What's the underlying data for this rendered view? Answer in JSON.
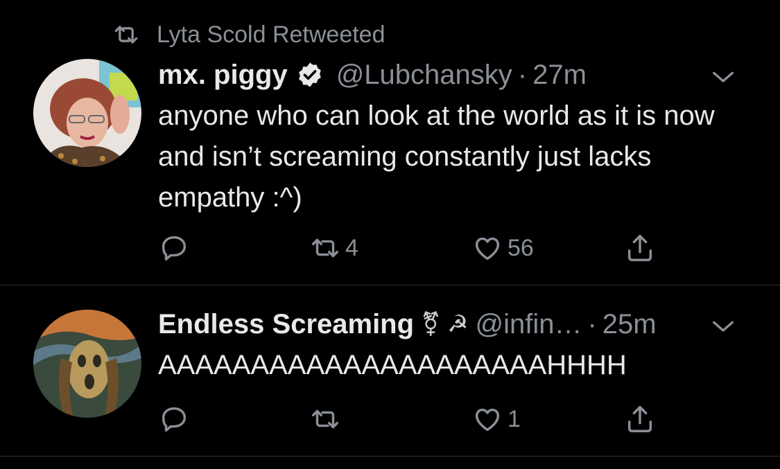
{
  "tweets": [
    {
      "retweeted_by": "Lyta Scold Retweeted",
      "display_name": "mx. piggy",
      "verified": true,
      "handle": "@Lubchansky",
      "separator": "·",
      "time": "27m",
      "text": "anyone who can look at the world as it is now and isn’t screaming constantly just lacks empathy :^)",
      "reply_count": "",
      "retweet_count": "4",
      "like_count": "56"
    },
    {
      "display_name": "Endless Screaming",
      "name_emoji": "⚧ ☭",
      "handle": "@infin…",
      "separator": "·",
      "time": "25m",
      "text": "AAAAAAAAAAAAAAAAAAAAAHHHH",
      "reply_count": "",
      "retweet_count": "",
      "like_count": "1"
    }
  ],
  "colors": {
    "background": "#000000",
    "primary_text": "#e7e9ea",
    "secondary_text": "#8b9097",
    "divider": "#2f3336"
  },
  "icons": [
    "retweet-icon",
    "verified-badge-icon",
    "chevron-down-icon",
    "reply-icon",
    "like-icon",
    "share-icon"
  ]
}
